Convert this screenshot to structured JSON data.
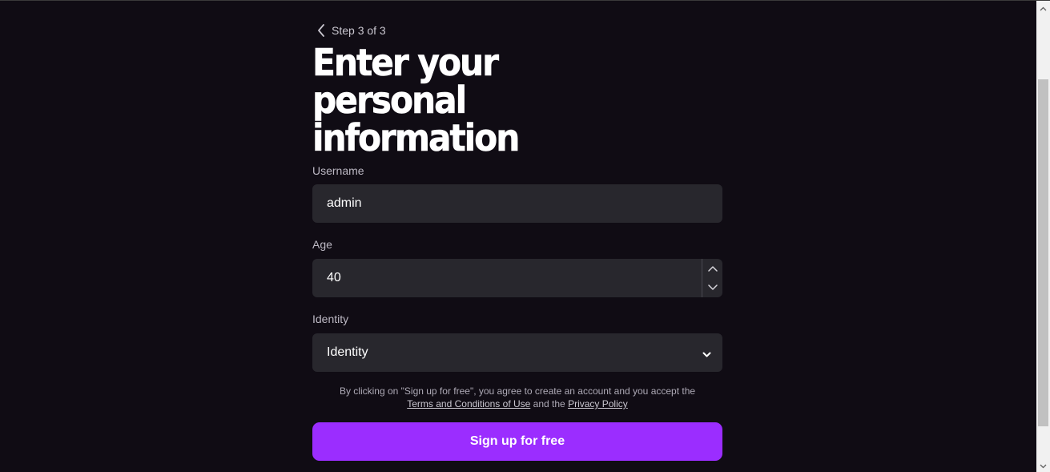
{
  "header": {
    "back_icon": "chevron-left-icon",
    "step_label": "Step 3 of 3",
    "title_line1": "Enter your personal",
    "title_line2": "information"
  },
  "form": {
    "username": {
      "label": "Username",
      "value": "admin"
    },
    "age": {
      "label": "Age",
      "value": "40",
      "stepper_up_icon": "chevron-up-icon",
      "stepper_down_icon": "chevron-down-icon"
    },
    "identity": {
      "label": "Identity",
      "selected": "Identity",
      "icon": "chevron-down-icon"
    }
  },
  "legal": {
    "text_before": "By clicking on \"Sign up for free\", you agree to create an account and you accept the",
    "terms_link": "Terms and Conditions of Use",
    "and_text": "and the",
    "privacy_link": "Privacy Policy"
  },
  "cta": {
    "label": "Sign up for free"
  },
  "colors": {
    "background": "#100c14",
    "input_background": "#28272d",
    "accent": "#9b2dff",
    "text_primary": "#ffffff",
    "text_muted": "#bdb9c4"
  }
}
